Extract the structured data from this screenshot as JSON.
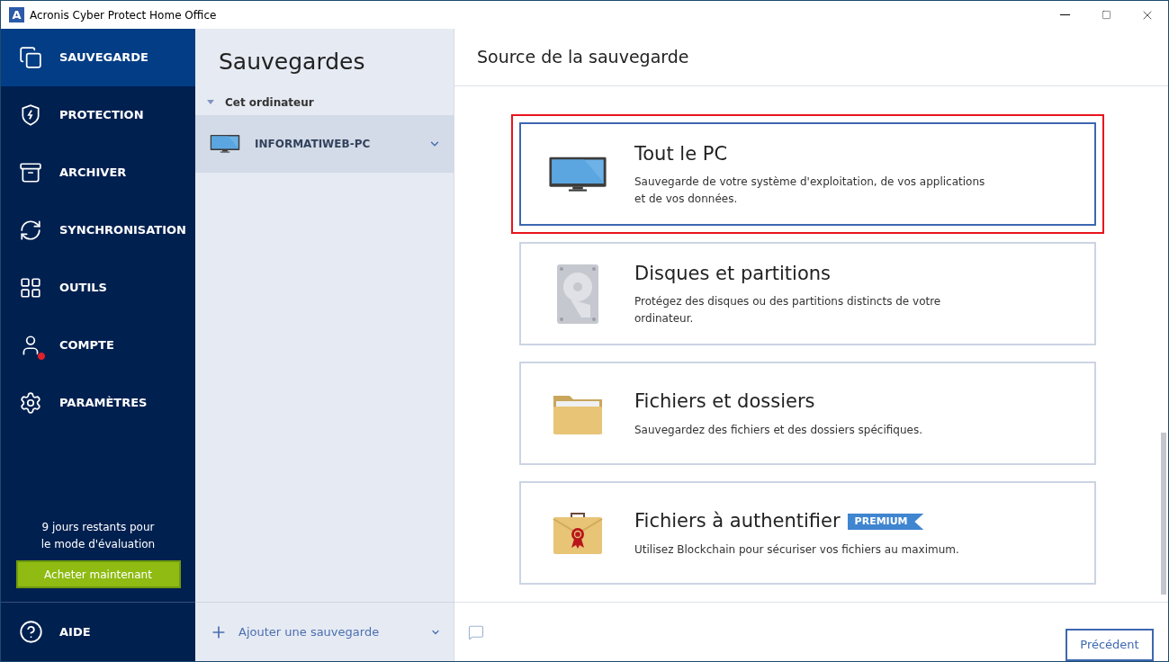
{
  "window": {
    "title": "Acronis Cyber Protect Home Office",
    "logo": "A"
  },
  "sidebar": {
    "items": [
      {
        "label": "SAUVEGARDE",
        "selected": true,
        "alert": false
      },
      {
        "label": "PROTECTION",
        "selected": false,
        "alert": false
      },
      {
        "label": "ARCHIVER",
        "selected": false,
        "alert": false
      },
      {
        "label": "SYNCHRONISATION",
        "selected": false,
        "alert": false
      },
      {
        "label": "OUTILS",
        "selected": false,
        "alert": false
      },
      {
        "label": "COMPTE",
        "selected": false,
        "alert": true
      },
      {
        "label": "PARAMÈTRES",
        "selected": false,
        "alert": false
      }
    ],
    "trial": {
      "text": "9 jours restants pour le mode d'évaluation",
      "button": "Acheter maintenant"
    },
    "help": {
      "label": "AIDE"
    }
  },
  "backups": {
    "title": "Sauvegardes",
    "group": {
      "label": "Cet ordinateur",
      "expanded": true,
      "items": [
        {
          "label": "INFORMATIWEB-PC",
          "selected": true
        }
      ]
    },
    "add": "Ajouter une sauvegarde"
  },
  "source": {
    "title": "Source de la sauvegarde",
    "options": [
      {
        "kind": "pc",
        "title": "Tout le PC",
        "description": "Sauvegarde de votre système d'exploitation, de vos applications et de vos données.",
        "selected": true,
        "highlighted": true
      },
      {
        "kind": "disk",
        "title": "Disques et partitions",
        "description": "Protégez des disques ou des partitions distincts de votre ordinateur.",
        "selected": false,
        "highlighted": false
      },
      {
        "kind": "folder",
        "title": "Fichiers et dossiers",
        "description": "Sauvegardez des fichiers et des dossiers spécifiques.",
        "selected": false,
        "highlighted": false
      },
      {
        "kind": "notary",
        "title": "Fichiers à authentifier",
        "badge": "PREMIUM",
        "description": "Utilisez Blockchain pour sécuriser vos fichiers au maximum.",
        "selected": false,
        "highlighted": false
      }
    ],
    "back_button": "Précédent"
  }
}
